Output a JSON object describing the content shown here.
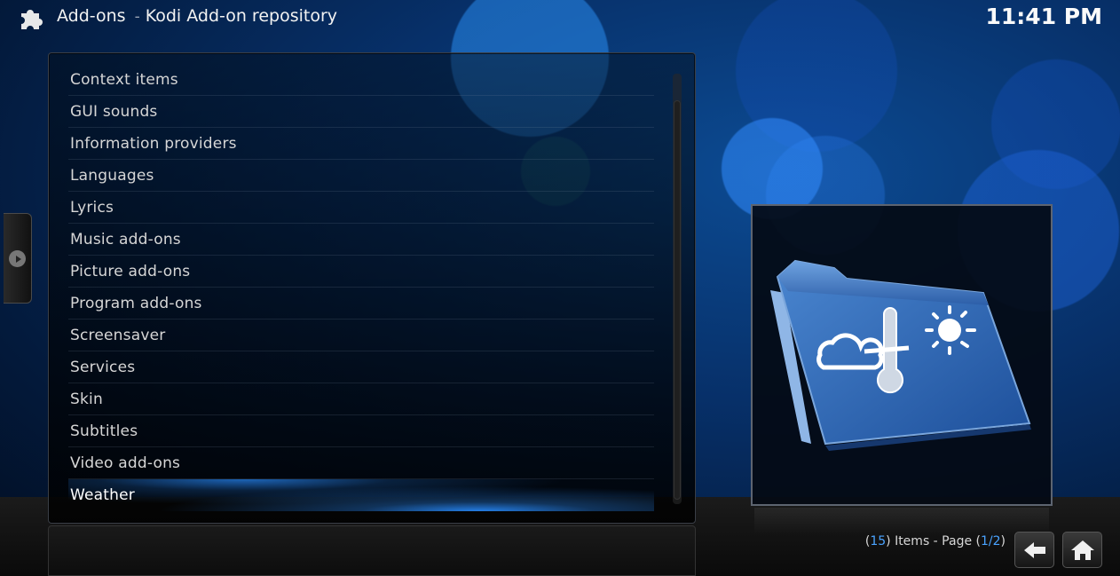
{
  "header": {
    "section": "Add-ons",
    "separator": "-",
    "subtitle": "Kodi Add-on repository",
    "clock": "11:41 PM",
    "icon": "puzzle-piece-icon"
  },
  "list": {
    "items": [
      "Context items",
      "GUI sounds",
      "Information providers",
      "Languages",
      "Lyrics",
      "Music add-ons",
      "Picture add-ons",
      "Program add-ons",
      "Screensaver",
      "Services",
      "Skin",
      "Subtitles",
      "Video add-ons",
      "Weather"
    ],
    "selected_index": 13
  },
  "preview": {
    "icon": "weather-folder-icon"
  },
  "footer": {
    "paren_open": "(",
    "item_count": "15",
    "items_label": ") Items - Page (",
    "page": "1/2",
    "paren_close": ")",
    "back_icon": "back-arrow-icon",
    "home_icon": "home-icon"
  },
  "colors": {
    "accent": "#4aa3ff",
    "background": "#073069"
  }
}
